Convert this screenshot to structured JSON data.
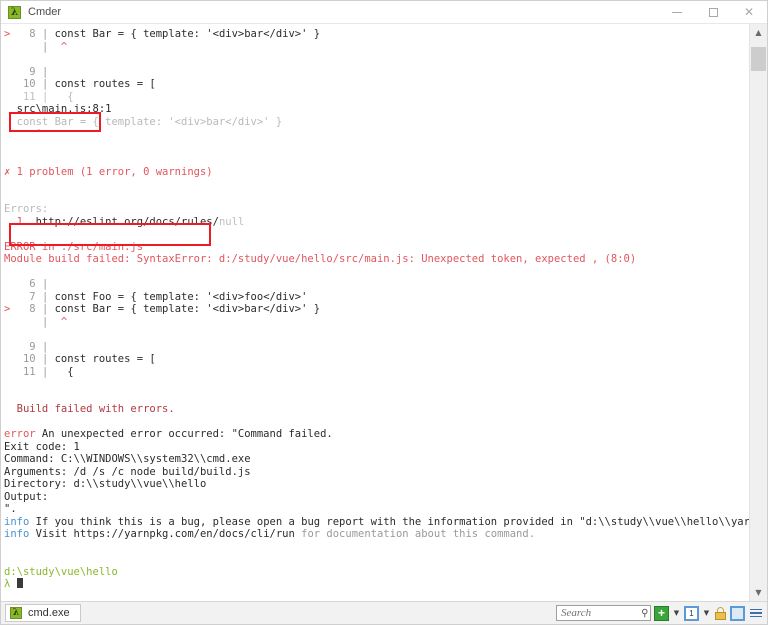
{
  "window": {
    "title": "Cmder",
    "app_icon": "cmder-lambda-icon",
    "minimize_label": "Minimize",
    "maximize_label": "Maximize",
    "close_label": "✕"
  },
  "terminal": {
    "lines": [
      {
        "id": "l01",
        "segments": [
          {
            "t": ">",
            "c": "c-red"
          },
          {
            "t": "   8 ",
            "c": "c-gray"
          },
          {
            "t": "| ",
            "c": "c-gray"
          },
          {
            "t": "const Bar = { template: '<div>bar</div>' }",
            "c": "c-dark"
          }
        ]
      },
      {
        "id": "l02",
        "segments": [
          {
            "t": "      ",
            "c": "c-gray"
          },
          {
            "t": "| ",
            "c": "c-gray"
          },
          {
            "t": " ^",
            "c": "c-red"
          }
        ]
      },
      {
        "id": "l03",
        "segments": [
          {
            "t": "",
            "c": "c-dark"
          }
        ]
      },
      {
        "id": "l04",
        "segments": [
          {
            "t": "    9 ",
            "c": "c-gray"
          },
          {
            "t": "|",
            "c": "c-gray"
          }
        ]
      },
      {
        "id": "l05",
        "segments": [
          {
            "t": "   10 ",
            "c": "c-gray"
          },
          {
            "t": "| ",
            "c": "c-gray"
          },
          {
            "t": "const routes = [",
            "c": "c-dark"
          }
        ]
      },
      {
        "id": "l06",
        "segments": [
          {
            "t": "   11 ",
            "c": "c-gray-lt"
          },
          {
            "t": "| ",
            "c": "c-gray-lt"
          },
          {
            "t": "  {",
            "c": "c-faded-d"
          }
        ]
      },
      {
        "id": "l07",
        "segments": [
          {
            "t": "  src\\main.js:8:1",
            "c": "c-dark"
          }
        ]
      },
      {
        "id": "l08",
        "segments": [
          {
            "t": "  const Bar = { template: '<div>bar</div>' }",
            "c": "c-faded-d"
          }
        ]
      },
      {
        "id": "l09",
        "segments": [
          {
            "t": "     ^",
            "c": "c-faded"
          }
        ]
      },
      {
        "id": "l10",
        "segments": [
          {
            "t": "",
            "c": "c-dark"
          }
        ]
      },
      {
        "id": "l11",
        "segments": [
          {
            "t": "",
            "c": "c-dark"
          }
        ]
      },
      {
        "id": "l12",
        "segments": [
          {
            "t": "✗ 1 problem (1 error, 0 warnings)",
            "c": "c-red"
          }
        ]
      },
      {
        "id": "l13",
        "segments": [
          {
            "t": "",
            "c": "c-dark"
          }
        ]
      },
      {
        "id": "l14",
        "segments": [
          {
            "t": "",
            "c": "c-dark"
          }
        ]
      },
      {
        "id": "l15",
        "segments": [
          {
            "t": "Errors:",
            "c": "c-faded-d"
          }
        ]
      },
      {
        "id": "l16",
        "segments": [
          {
            "t": "  1  ",
            "c": "c-red"
          },
          {
            "t": "http://eslint.org/docs/rules/",
            "c": "c-dark"
          },
          {
            "t": "null",
            "c": "c-gray-lt"
          }
        ]
      },
      {
        "id": "l17",
        "segments": [
          {
            "t": "",
            "c": "c-dark"
          }
        ]
      },
      {
        "id": "l18",
        "segments": [
          {
            "t": "ERROR in ./src/main.js",
            "c": "c-red"
          }
        ]
      },
      {
        "id": "l19",
        "segments": [
          {
            "t": "Module build failed: SyntaxError: d:/study/vue/hello/src/main.js: Unexpected token, expected , (8:0)",
            "c": "c-red"
          }
        ]
      },
      {
        "id": "l20",
        "segments": [
          {
            "t": "",
            "c": "c-dark"
          }
        ]
      },
      {
        "id": "l21",
        "segments": [
          {
            "t": "    6 ",
            "c": "c-gray"
          },
          {
            "t": "|",
            "c": "c-gray"
          }
        ]
      },
      {
        "id": "l22",
        "segments": [
          {
            "t": "    7 ",
            "c": "c-gray"
          },
          {
            "t": "| ",
            "c": "c-gray"
          },
          {
            "t": "const Foo = { template: '<div>foo</div>'",
            "c": "c-dark"
          }
        ]
      },
      {
        "id": "l23",
        "segments": [
          {
            "t": ">",
            "c": "c-red"
          },
          {
            "t": "   8 ",
            "c": "c-gray"
          },
          {
            "t": "| ",
            "c": "c-gray"
          },
          {
            "t": "const Bar = { template: '<div>bar</div>' }",
            "c": "c-dark"
          }
        ]
      },
      {
        "id": "l24",
        "segments": [
          {
            "t": "      ",
            "c": "c-gray"
          },
          {
            "t": "| ",
            "c": "c-gray"
          },
          {
            "t": " ^",
            "c": "c-red"
          }
        ]
      },
      {
        "id": "l25",
        "segments": [
          {
            "t": "",
            "c": "c-dark"
          }
        ]
      },
      {
        "id": "l26",
        "segments": [
          {
            "t": "    9 ",
            "c": "c-gray"
          },
          {
            "t": "|",
            "c": "c-gray"
          }
        ]
      },
      {
        "id": "l27",
        "segments": [
          {
            "t": "   10 ",
            "c": "c-gray"
          },
          {
            "t": "| ",
            "c": "c-gray"
          },
          {
            "t": "const routes = [",
            "c": "c-dark"
          }
        ]
      },
      {
        "id": "l28",
        "segments": [
          {
            "t": "   11 ",
            "c": "c-gray"
          },
          {
            "t": "| ",
            "c": "c-gray"
          },
          {
            "t": "  {",
            "c": "c-dark"
          }
        ]
      },
      {
        "id": "l29",
        "segments": [
          {
            "t": "",
            "c": "c-dark"
          }
        ]
      },
      {
        "id": "l30",
        "segments": [
          {
            "t": "",
            "c": "c-dark"
          }
        ]
      },
      {
        "id": "l31",
        "segments": [
          {
            "t": "  Build failed with errors.",
            "c": "c-red-dk"
          }
        ]
      },
      {
        "id": "l32",
        "segments": [
          {
            "t": "",
            "c": "c-dark"
          }
        ]
      },
      {
        "id": "l33",
        "segments": [
          {
            "t": "error",
            "c": "c-red"
          },
          {
            "t": " An unexpected error occurred: \"Command failed.",
            "c": "c-dark"
          }
        ]
      },
      {
        "id": "l34",
        "segments": [
          {
            "t": "Exit code: 1",
            "c": "c-dark"
          }
        ]
      },
      {
        "id": "l35",
        "segments": [
          {
            "t": "Command: C:\\\\WINDOWS\\\\system32\\\\cmd.exe",
            "c": "c-dark"
          }
        ]
      },
      {
        "id": "l36",
        "segments": [
          {
            "t": "Arguments: /d /s /c node build/build.js",
            "c": "c-dark"
          }
        ]
      },
      {
        "id": "l37",
        "segments": [
          {
            "t": "Directory: d:\\\\study\\\\vue\\\\hello",
            "c": "c-dark"
          }
        ]
      },
      {
        "id": "l38",
        "segments": [
          {
            "t": "Output:",
            "c": "c-dark"
          }
        ]
      },
      {
        "id": "l39",
        "segments": [
          {
            "t": "\".",
            "c": "c-dark"
          }
        ]
      },
      {
        "id": "l40",
        "segments": [
          {
            "t": "info",
            "c": "c-blue"
          },
          {
            "t": " If you think this is a bug, please open a bug report with the information provided in \"d:\\\\study\\\\vue\\\\hello\\\\yarn-error.log\".",
            "c": "c-dark"
          }
        ]
      },
      {
        "id": "l41",
        "segments": [
          {
            "t": "info",
            "c": "c-blue"
          },
          {
            "t": " Visit https://yarnpkg.com/en/docs/cli/run ",
            "c": "c-dark"
          },
          {
            "t": "for documentation about this command.",
            "c": "c-gray"
          }
        ]
      },
      {
        "id": "l42",
        "segments": [
          {
            "t": "",
            "c": "c-dark"
          }
        ]
      },
      {
        "id": "l43",
        "segments": [
          {
            "t": "",
            "c": "c-dark"
          }
        ]
      },
      {
        "id": "l44",
        "segments": [
          {
            "t": "d:\\study\\vue\\hello",
            "c": "c-green"
          }
        ]
      }
    ],
    "prompt_symbol": "λ",
    "annotations": [
      {
        "id": "annot-1",
        "label": "src\\main.js:8:1 highlight"
      },
      {
        "id": "annot-2",
        "label": "eslint rule url highlight"
      }
    ]
  },
  "scrollbar": {
    "up_arrow": "▲",
    "down_arrow": "▼"
  },
  "statusbar": {
    "tab": {
      "label": "cmd.exe",
      "icon": "cmder-lambda-icon"
    },
    "search": {
      "placeholder": "Search",
      "value": ""
    },
    "buttons": {
      "new_console": "+",
      "new_console_caret": "▼",
      "active_console": "1",
      "console_caret": "▼",
      "lock": "lock-icon",
      "window": "window-icon",
      "menu": "hamburger-menu-icon"
    }
  },
  "colors": {
    "accent_green": "#8ab82b",
    "error_red": "#e0575f",
    "info_blue": "#4a8fd6",
    "annotation_red": "#ee1b24",
    "background": "#ffffff"
  }
}
